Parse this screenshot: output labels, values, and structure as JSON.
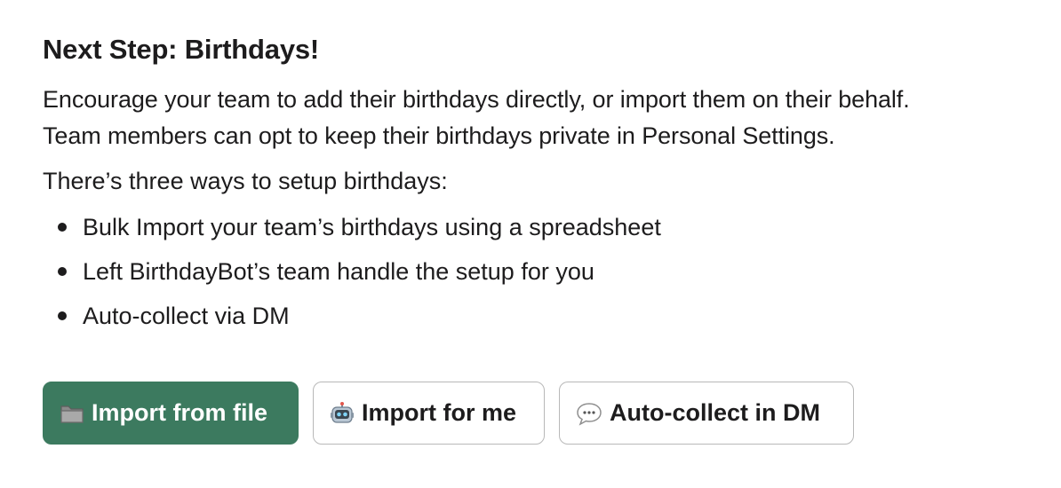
{
  "title": "Next Step: Birthdays!",
  "description": [
    "Encourage your team to add their birthdays directly, or import them on their behalf.",
    "Team members can opt to keep their birthdays private in Personal Settings."
  ],
  "ways_intro": "There’s three ways to setup birthdays:",
  "ways": [
    "Bulk Import your team’s birthdays using a spreadsheet",
    "Left BirthdayBot’s team handle the setup for you",
    "Auto-collect via DM"
  ],
  "buttons": {
    "import_file": {
      "label": "Import from file",
      "icon": "folder-icon"
    },
    "import_me": {
      "label": "Import for me",
      "icon": "robot-icon"
    },
    "auto_collect": {
      "label": "Auto-collect in DM",
      "icon": "speech-bubble-icon"
    }
  },
  "colors": {
    "primary_button": "#3c7a5f",
    "text": "#1d1c1d",
    "secondary_border": "#b8b8b8"
  }
}
